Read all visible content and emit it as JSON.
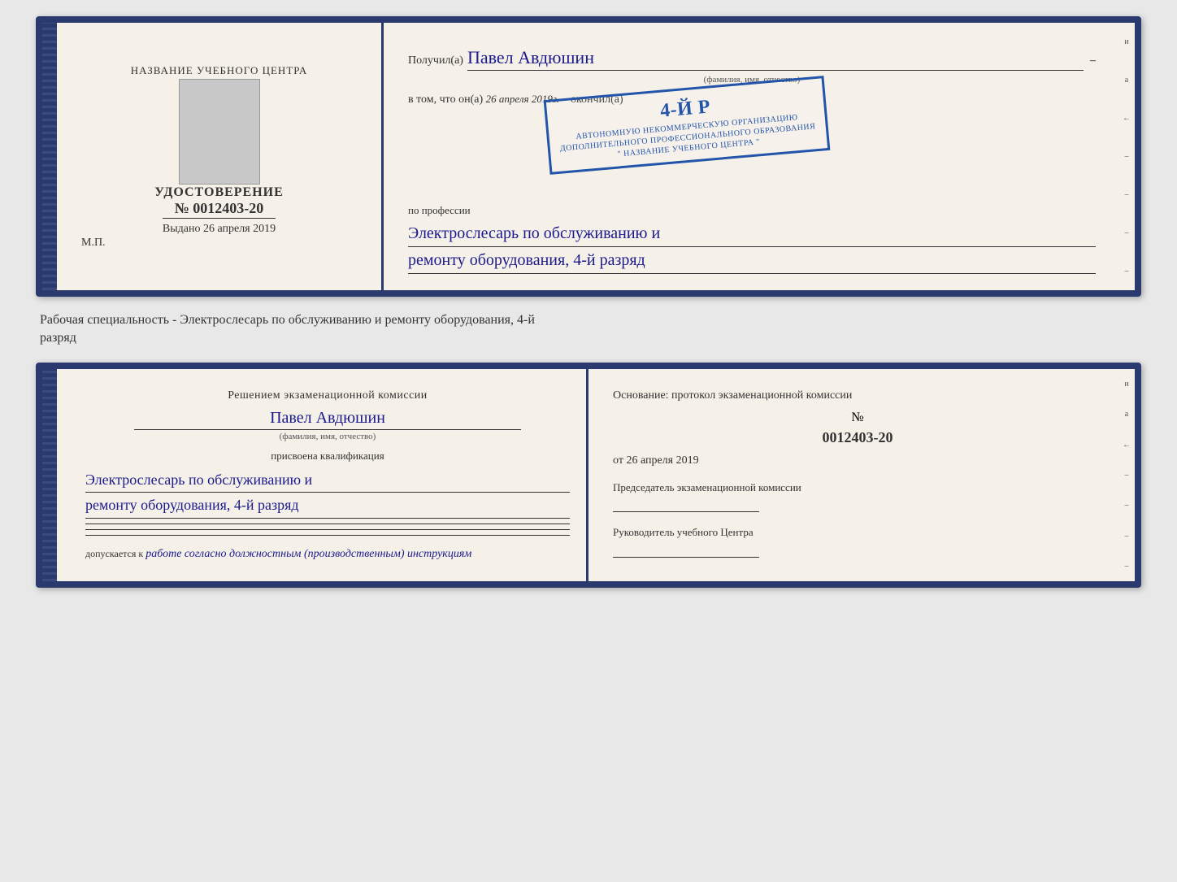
{
  "top_doc": {
    "left": {
      "title": "НАЗВАНИЕ УЧЕБНОГО ЦЕНТРА",
      "udostoverenie_label": "УДОСТОВЕРЕНИЕ",
      "number_prefix": "№",
      "number": "0012403-20",
      "vydano_label": "Выдано",
      "vydano_date": "26 апреля 2019",
      "mp_label": "М.П."
    },
    "right": {
      "poluchil_label": "Получил(a)",
      "name_handwritten": "Павел Авдюшин",
      "fio_label": "(фамилия, имя, отчество)",
      "dash": "–",
      "vtom_label": "в том, что он(а)",
      "vtom_date": "26 апреля 2019г.",
      "okonchil_label": "окончил(а)",
      "stamp_number": "4-й р",
      "stamp_line1": "АВТОНОМНУЮ НЕКОММЕРЧЕСКУЮ ОРГАНИЗАЦИЮ",
      "stamp_line2": "ДОПОЛНИТЕЛЬНОГО ПРОФЕССИОНАЛЬНОГО ОБРАЗОВАНИЯ",
      "stamp_line3": "\" НАЗВАНИЕ УЧЕБНОГО ЦЕНТРА \"",
      "po_professii_label": "по профессии",
      "profession_line1": "Электрослесарь по обслуживанию и",
      "profession_line2": "ремонту оборудования, 4-й разряд"
    }
  },
  "middle_text": {
    "line1": "Рабочая специальность - Электрослесарь по обслуживанию и ремонту оборудования, 4-й",
    "line2": "разряд"
  },
  "bottom_doc": {
    "left": {
      "resheniem_label": "Решением экзаменационной комиссии",
      "name_handwritten": "Павел Авдюшин",
      "fio_label": "(фамилия, имя, отчество)",
      "prisvoena_label": "присвоена квалификация",
      "qualification_line1": "Электрослесарь по обслуживанию и",
      "qualification_line2": "ремонту оборудования, 4-й разряд",
      "dopuskaetsya_prefix": "допускается к",
      "dopuskaetsya_text": "работе согласно должностным (производственным) инструкциям"
    },
    "right": {
      "osnovanie_label": "Основание: протокол экзаменационной комиссии",
      "number_prefix": "№",
      "protocol_number": "0012403-20",
      "ot_prefix": "от",
      "ot_date": "26 апреля 2019",
      "predsedatel_label": "Председатель экзаменационной комиссии",
      "rukovoditel_label": "Руководитель учебного Центра"
    }
  },
  "right_side_chars": [
    "и",
    "а",
    "←",
    "–",
    "–",
    "–",
    "–"
  ],
  "spine_chars": [
    "и",
    "а",
    "←",
    "–",
    "–",
    "–",
    "–"
  ]
}
